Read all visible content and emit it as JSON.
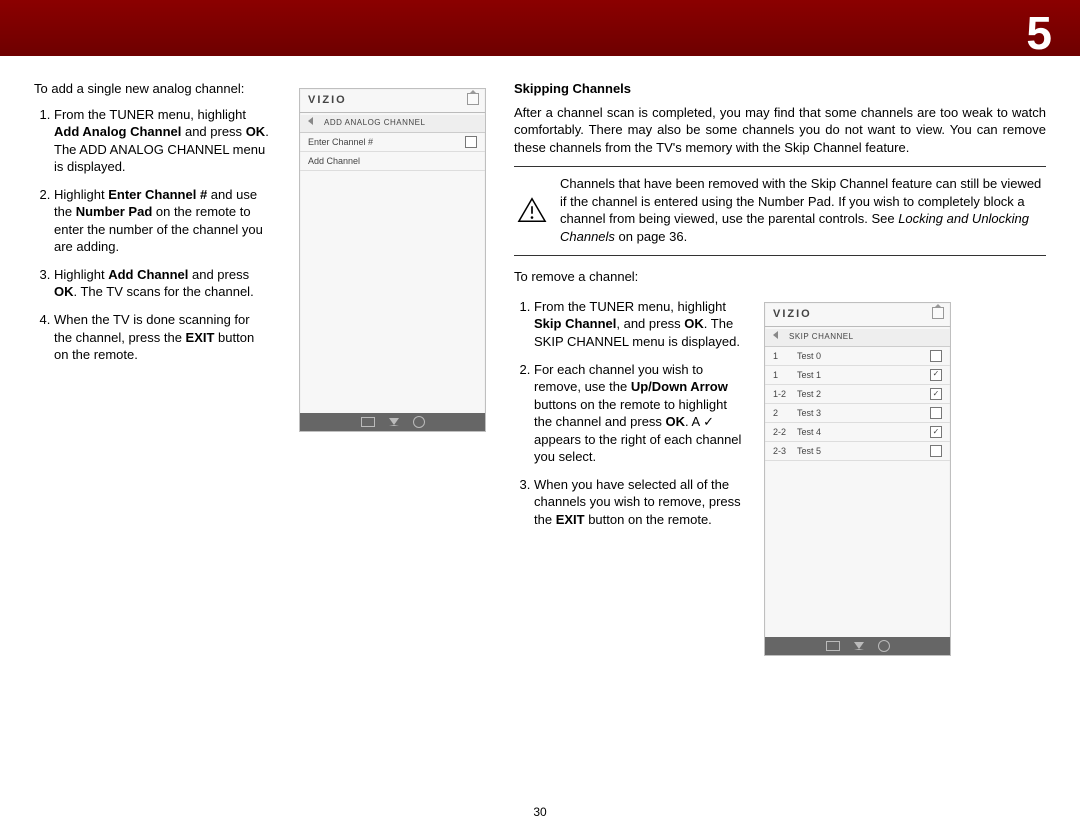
{
  "chapter_number": "5",
  "page_number": "30",
  "left": {
    "intro": "To add a single new analog channel:",
    "step1_a": "From the TUNER menu, highlight ",
    "step1_b": "Add Analog Channel",
    "step1_c": " and press ",
    "step1_d": "OK",
    "step1_e": ". The ADD ANALOG CHANNEL menu is displayed.",
    "step2_a": "Highlight ",
    "step2_b": "Enter Channel #",
    "step2_c": " and use the ",
    "step2_d": "Number Pad",
    "step2_e": " on the remote to enter the number of the channel you are adding.",
    "step3_a": "Highlight ",
    "step3_b": "Add Channel",
    "step3_c": " and press ",
    "step3_d": "OK",
    "step3_e": ". The TV scans for the channel.",
    "step4_a": "When the TV is done scanning for the channel, press the ",
    "step4_b": "EXIT",
    "step4_c": " button on the remote."
  },
  "tv1": {
    "logo": "VIZIO",
    "title": "ADD ANALOG CHANNEL",
    "row1": "Enter Channel #",
    "row2": "Add Channel"
  },
  "right": {
    "heading": "Skipping Channels",
    "para": "After a channel scan is completed, you may find that some channels are too weak to watch comfortably. There may also be some channels you do not want to view. You can remove these channels from the TV's memory with the Skip Channel feature.",
    "note_a": "Channels that have been removed with the Skip Channel feature can still be viewed if the channel is entered using the Number Pad. If you wish to completely block a channel from being viewed, use the parental controls. See ",
    "note_b": "Locking and Unlocking Channels",
    "note_c": " on page 36.",
    "intro2": "To remove a channel:",
    "r1_a": "From the TUNER menu, highlight ",
    "r1_b": "Skip Channel",
    "r1_c": ", and press ",
    "r1_d": "OK",
    "r1_e": ". The SKIP CHANNEL menu is displayed.",
    "r2_a": "For each channel you wish to remove, use the ",
    "r2_b": "Up/Down Arrow",
    "r2_c": " buttons on the remote to highlight the channel and press ",
    "r2_d": "OK",
    "r2_e": ". A ✓ appears to the right of each channel you select.",
    "r3_a": "When you have selected all of the channels you wish to remove, press the ",
    "r3_b": "EXIT",
    "r3_c": " button on the remote."
  },
  "tv2": {
    "logo": "VIZIO",
    "title": "SKIP CHANNEL",
    "rows": [
      {
        "num": "1",
        "name": "Test 0",
        "chk": ""
      },
      {
        "num": "1",
        "name": "Test 1",
        "chk": "✓"
      },
      {
        "num": "1-2",
        "name": "Test 2",
        "chk": "✓"
      },
      {
        "num": "2",
        "name": "Test 3",
        "chk": ""
      },
      {
        "num": "2-2",
        "name": "Test 4",
        "chk": "✓"
      },
      {
        "num": "2-3",
        "name": "Test 5",
        "chk": ""
      }
    ]
  }
}
